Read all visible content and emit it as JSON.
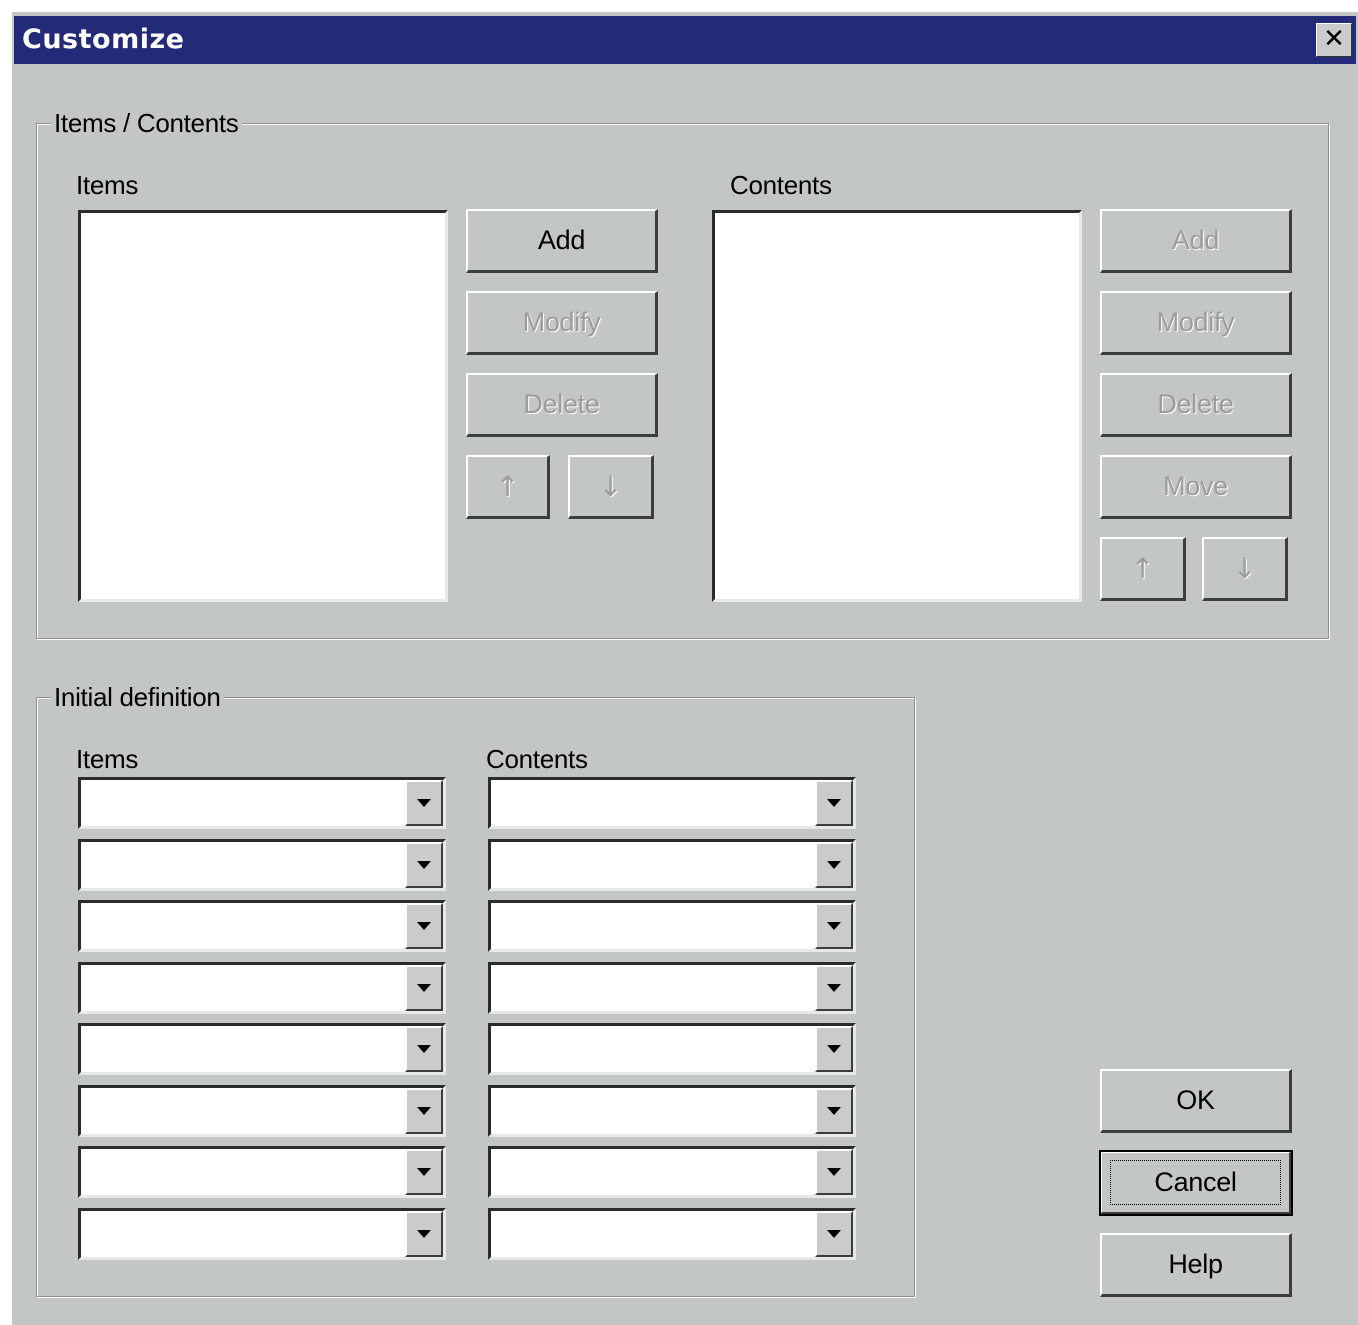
{
  "window": {
    "title": "Customize",
    "close_glyph": "✕",
    "close_icon": "close-icon"
  },
  "items_contents_group": {
    "legend": "Items / Contents",
    "items_label": "Items",
    "contents_label": "Contents",
    "items_buttons": {
      "add": "Add",
      "modify": "Modify",
      "delete": "Delete",
      "move_up_icon": "move-up-icon",
      "move_down_icon": "move-down-icon"
    },
    "contents_buttons": {
      "add": "Add",
      "modify": "Modify",
      "delete": "Delete",
      "move": "Move",
      "move_up_icon": "move-up-icon",
      "move_down_icon": "move-down-icon"
    }
  },
  "initial_definition_group": {
    "legend": "Initial definition",
    "items_label": "Items",
    "contents_label": "Contents",
    "items_values": [
      "",
      "",
      "",
      "",
      "",
      "",
      "",
      ""
    ],
    "contents_values": [
      "",
      "",
      "",
      "",
      "",
      "",
      "",
      ""
    ]
  },
  "dialog_buttons": {
    "ok": "OK",
    "cancel": "Cancel",
    "help": "Help"
  },
  "colors": {
    "titlebar": "#232a77",
    "face": "#c3c6c7",
    "disabled_text": "#9a9c9d"
  }
}
